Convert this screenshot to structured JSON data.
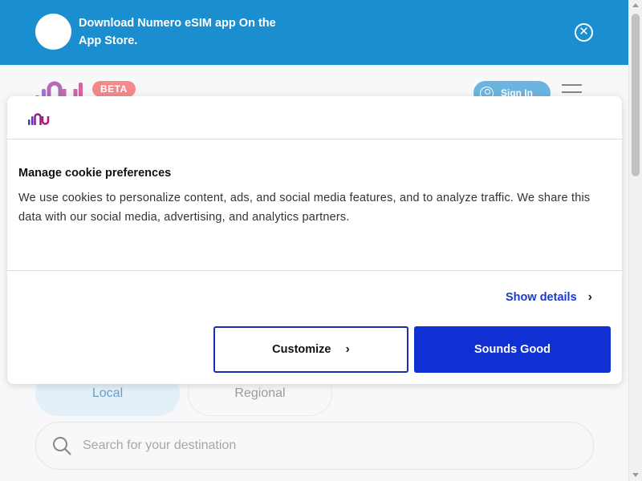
{
  "app_banner": {
    "text": "Download Numero eSIM app On the App Store.",
    "close_icon": "close-circle-icon"
  },
  "header": {
    "beta_label": "BETA",
    "signin_label": "Sign In",
    "signin_icon": "user-circle-icon",
    "menu_icon": "hamburger-menu-icon"
  },
  "tabs": [
    {
      "label": "Local",
      "selected": true
    },
    {
      "label": "Regional",
      "selected": false
    }
  ],
  "search": {
    "placeholder": "Search for your destination",
    "icon": "search-icon"
  },
  "cookie_dialog": {
    "title": "Manage cookie preferences",
    "body": "We use cookies to personalize content, ads, and social media features, and to analyze traffic. We share this data with our social media, advertising, and analytics partners.",
    "show_details_label": "Show details",
    "customize_label": "Customize",
    "accept_label": "Sounds Good"
  },
  "colors": {
    "banner_blue": "#1b8ecf",
    "primary_button": "#1130d4",
    "link_blue": "#1a3ac8",
    "beta_red": "#f04a4a"
  }
}
